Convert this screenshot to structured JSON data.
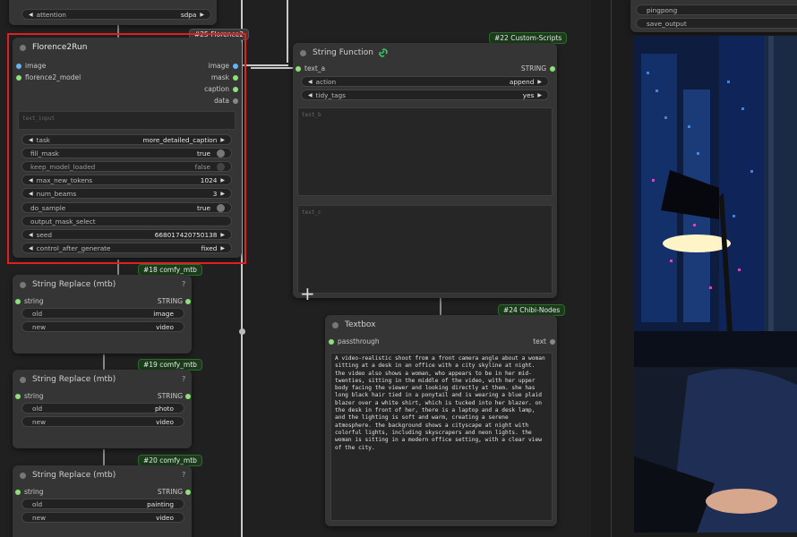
{
  "top_strip": {
    "left_widget_label": "attention",
    "left_widget_value": "sdpa",
    "right_widgets": [
      "pingpong",
      "save_output"
    ]
  },
  "florence_node": {
    "badge": "#25 Florence2",
    "title": "Florence2Run",
    "inputs": [
      "image",
      "florence2_model"
    ],
    "outputs": [
      "image",
      "mask",
      "caption",
      "data"
    ],
    "text_input_placeholder": "text_input",
    "widgets": [
      {
        "label": "task",
        "value": "more_detailed_caption",
        "kind": "combo"
      },
      {
        "label": "fill_mask",
        "value": "true",
        "kind": "toggle_on"
      },
      {
        "label": "keep_model_loaded",
        "value": "false",
        "kind": "toggle_off"
      },
      {
        "label": "max_new_tokens",
        "value": "1024",
        "kind": "number"
      },
      {
        "label": "num_beams",
        "value": "3",
        "kind": "number"
      },
      {
        "label": "do_sample",
        "value": "true",
        "kind": "toggle_on"
      },
      {
        "label": "output_mask_select",
        "value": "",
        "kind": "text"
      },
      {
        "label": "seed",
        "value": "668017420750138",
        "kind": "number"
      },
      {
        "label": "control_after_generate",
        "value": "fixed",
        "kind": "combo"
      }
    ]
  },
  "string_replace_nodes": [
    {
      "badge": "#18 comfy_mtb",
      "title": "String Replace (mtb)",
      "input": "string",
      "output": "STRING",
      "old": "old",
      "old_value": "image",
      "new": "new",
      "new_value": "video",
      "q": "?"
    },
    {
      "badge": "#19 comfy_mtb",
      "title": "String Replace (mtb)",
      "input": "string",
      "output": "STRING",
      "old": "old",
      "old_value": "photo",
      "new": "new",
      "new_value": "video",
      "q": "?"
    },
    {
      "badge": "#20 comfy_mtb",
      "title": "String Replace (mtb)",
      "input": "string",
      "output": "STRING",
      "old": "old",
      "old_value": "painting",
      "new": "new",
      "new_value": "video",
      "q": "?"
    }
  ],
  "string_function_node": {
    "badge": "#22 Custom-Scripts",
    "title": "String Function",
    "input": "text_a",
    "output": "STRING",
    "action_label": "action",
    "action_value": "append",
    "tidy_label": "tidy_tags",
    "tidy_value": "yes",
    "text_b_placeholder": "text_b",
    "text_c_placeholder": "text_c"
  },
  "textbox_node": {
    "badge": "#24 Chibi-Nodes",
    "title": "Textbox",
    "input": "passthrough",
    "output": "text",
    "content": "A video-realistic shoot from a front camera angle about a woman sitting at a desk in an office with a city skyline at night. the video also shows a woman, who appears to be in her mid-twenties, sitting in the middle of the video, with her upper body facing the viewer and looking directly at them. she has long black hair tied in a ponytail and is wearing a blue plaid blazer over a white shirt, which is tucked into her blazer. on the desk in front of her, there is a laptop and a desk lamp, and the lighting is soft and warm, creating a serene atmosphere. the background shows a cityscape at night with colorful lights, including skyscrapers and neon lights. the woman is sitting in a modern office setting, with a clear view of the city."
  },
  "colors": {
    "canvas": "#202020",
    "node": "#353535",
    "badge_bg": "#1b3b1b",
    "selection": "#e02020",
    "socket_image": "#64b5f6",
    "socket_string": "#8ee07a"
  }
}
